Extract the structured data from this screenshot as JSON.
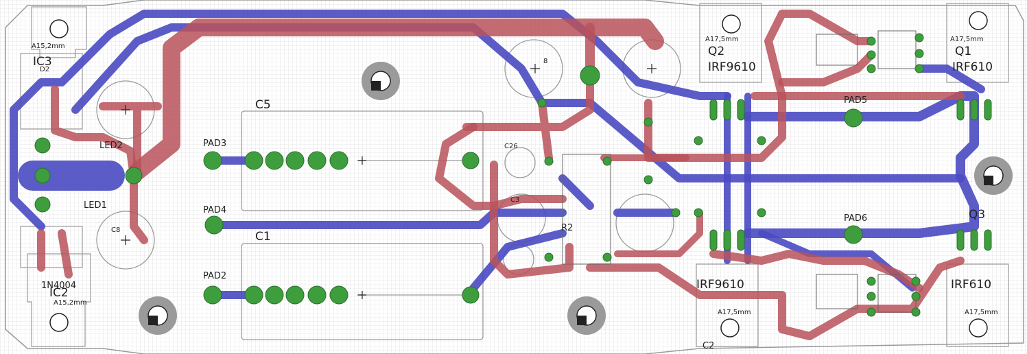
{
  "colors": {
    "background": "#ffffff",
    "grid": "#d2d2d2",
    "board_outline": "#9a9a9a",
    "top_copper": "#b8525a",
    "bottom_copper": "#4a4ac2",
    "pad": "#3e9e3e",
    "silk": "#8a8a8a"
  },
  "labels": {
    "ic3": "IC3",
    "ic2": "IC2",
    "d2": "D2",
    "led2": "LED2",
    "led1": "LED1",
    "c8": "C8",
    "c5": "C5",
    "c1": "C1",
    "c26": "C26",
    "c3": "C3",
    "r2": "R2",
    "q1": "Q1",
    "q2": "Q2",
    "q3": "Q3",
    "irf9610_top": "IRF9610",
    "irf610_top": "IRF610",
    "irf9610_bot": "IRF9610",
    "irf610_bot": "IRF610",
    "pad2": "PAD2",
    "pad3": "PAD3",
    "pad4": "PAD4",
    "pad5": "PAD5",
    "pad6": "PAD6",
    "d1n4004": "1N4004",
    "hs_ic3": "A15,2mm",
    "hs_ic2": "A15,2mm",
    "hs_q2": "A17,5mm",
    "hs_q1": "A17,5mm",
    "hs_bl": "A17,5mm",
    "hs_br": "A17,5mm",
    "c2": "C2",
    "r8": "8"
  }
}
